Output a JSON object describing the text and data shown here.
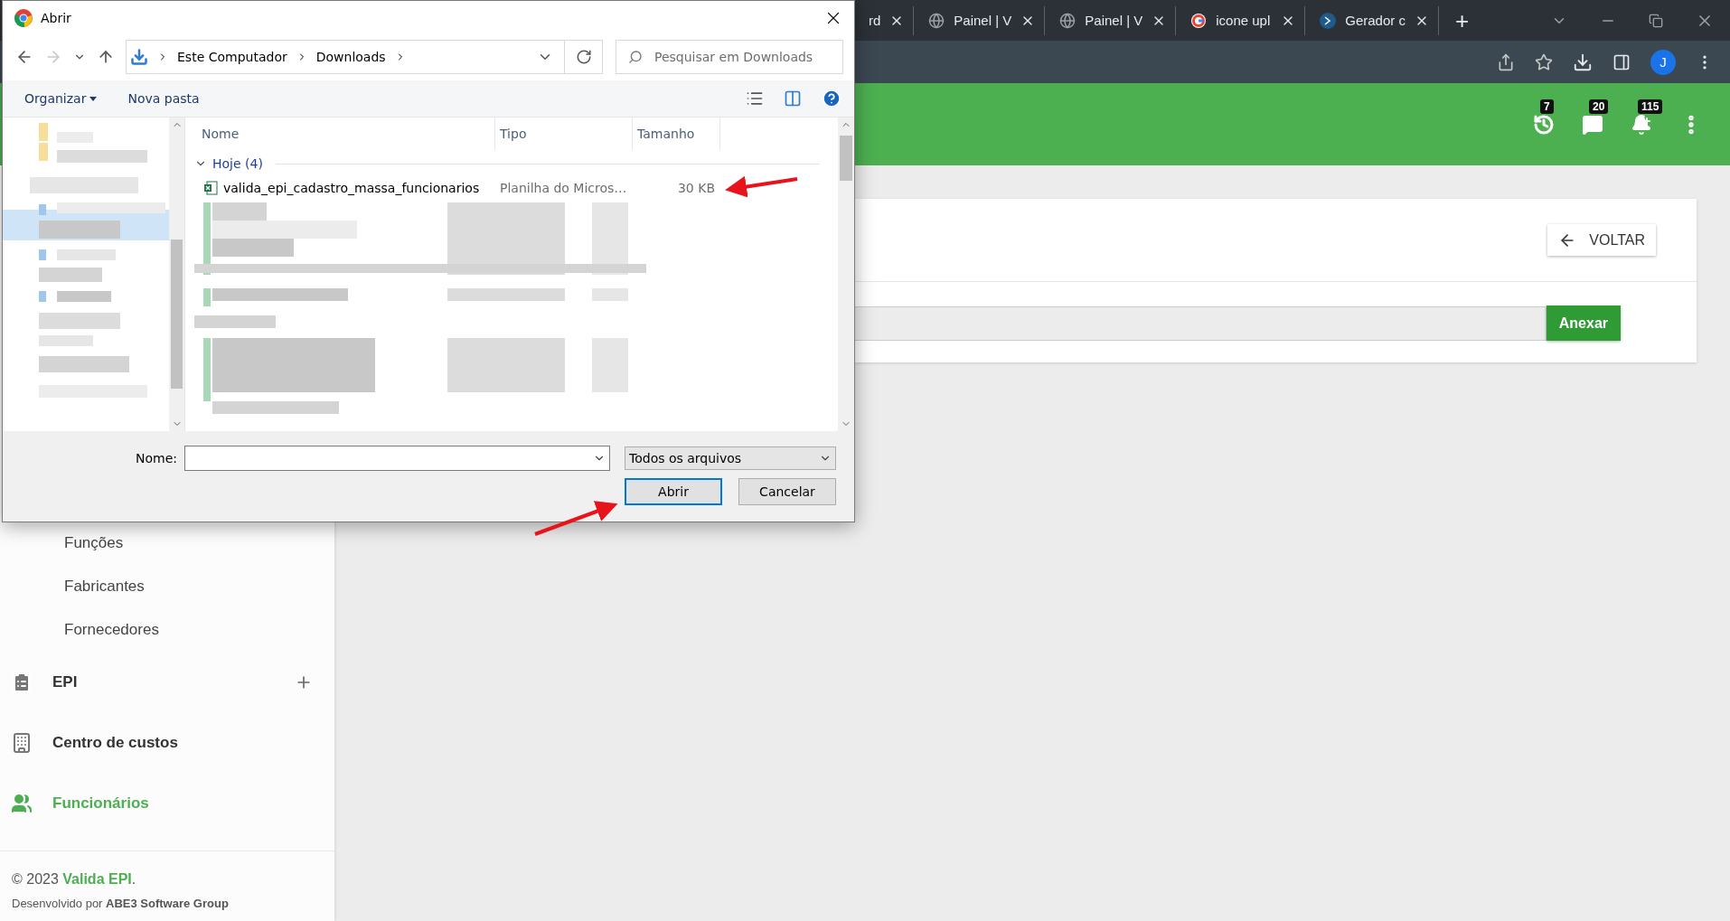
{
  "browser": {
    "tabs": [
      {
        "title": "rd",
        "kind": "partial",
        "selected": false
      },
      {
        "title": "Painel | V",
        "kind": "globe",
        "selected": false
      },
      {
        "title": "Painel | V",
        "kind": "globe",
        "selected": false
      },
      {
        "title": "icone upl",
        "kind": "google",
        "selected": false
      },
      {
        "title": "Gerador c",
        "kind": "site",
        "selected": false
      }
    ],
    "new_tab": "+",
    "profile": "J"
  },
  "header": {
    "notifications": [
      {
        "kind": "history",
        "count": "7"
      },
      {
        "kind": "alert",
        "count": "20"
      },
      {
        "kind": "bell",
        "count": "115"
      }
    ]
  },
  "sidebar": {
    "items": [
      {
        "label": "Funções",
        "kind": "sub",
        "selected": false
      },
      {
        "label": "Fabricantes",
        "kind": "sub",
        "selected": false
      },
      {
        "label": "Fornecedores",
        "kind": "sub",
        "selected": false
      },
      {
        "label": "EPI",
        "kind": "section",
        "expandable": true,
        "selected": false
      },
      {
        "label": "Centro de custos",
        "kind": "section",
        "expandable": false,
        "selected": false
      },
      {
        "label": "Funcionários",
        "kind": "section",
        "expandable": false,
        "selected": true
      }
    ],
    "footer": {
      "copyright": "© 2023",
      "brand": "Valida EPI",
      "suffix": ".",
      "credit": "Desenvolvido por **ABE3 Software Group**"
    }
  },
  "content": {
    "back_button": "VOLTAR",
    "attach_button": "Anexar"
  },
  "dialog": {
    "title": "Abrir",
    "path": [
      "Este Computador",
      "Downloads"
    ],
    "search_placeholder": "Pesquisar em Downloads",
    "toolbar": [
      "Organizar",
      "Nova pasta"
    ],
    "columns": [
      "Nome",
      "Tipo",
      "Tamanho"
    ],
    "groups": [
      {
        "label": "Hoje (4)",
        "expanded": true,
        "files": [
          {
            "name": "valida_epi_cadastro_massa_funcionarios",
            "type": "Planilha do Micros…",
            "size": "30 KB"
          }
        ]
      }
    ],
    "filename_label": "Nome:",
    "filter": "Todos os arquivos",
    "buttons": [
      {
        "label": "Abrir",
        "kind": "primary"
      },
      {
        "label": "Cancelar",
        "kind": "secondary"
      }
    ]
  }
}
